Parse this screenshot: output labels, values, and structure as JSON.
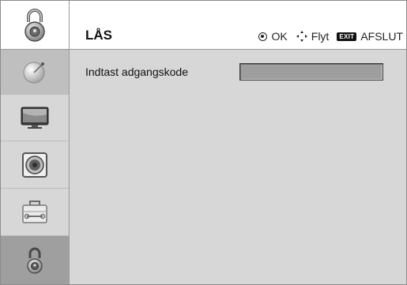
{
  "header": {
    "title": "LÅS",
    "hint_ok": "OK",
    "hint_move": "Flyt",
    "hint_exit_badge": "EXIT",
    "hint_exit": "AFSLUT"
  },
  "sidebar": {
    "items": [
      {
        "icon": "satellite-dish-icon"
      },
      {
        "icon": "tv-screen-icon"
      },
      {
        "icon": "speaker-icon"
      },
      {
        "icon": "toolbox-icon"
      },
      {
        "icon": "padlock-icon"
      }
    ]
  },
  "content": {
    "field_label": "Indtast adgangskode",
    "field_value": ""
  }
}
